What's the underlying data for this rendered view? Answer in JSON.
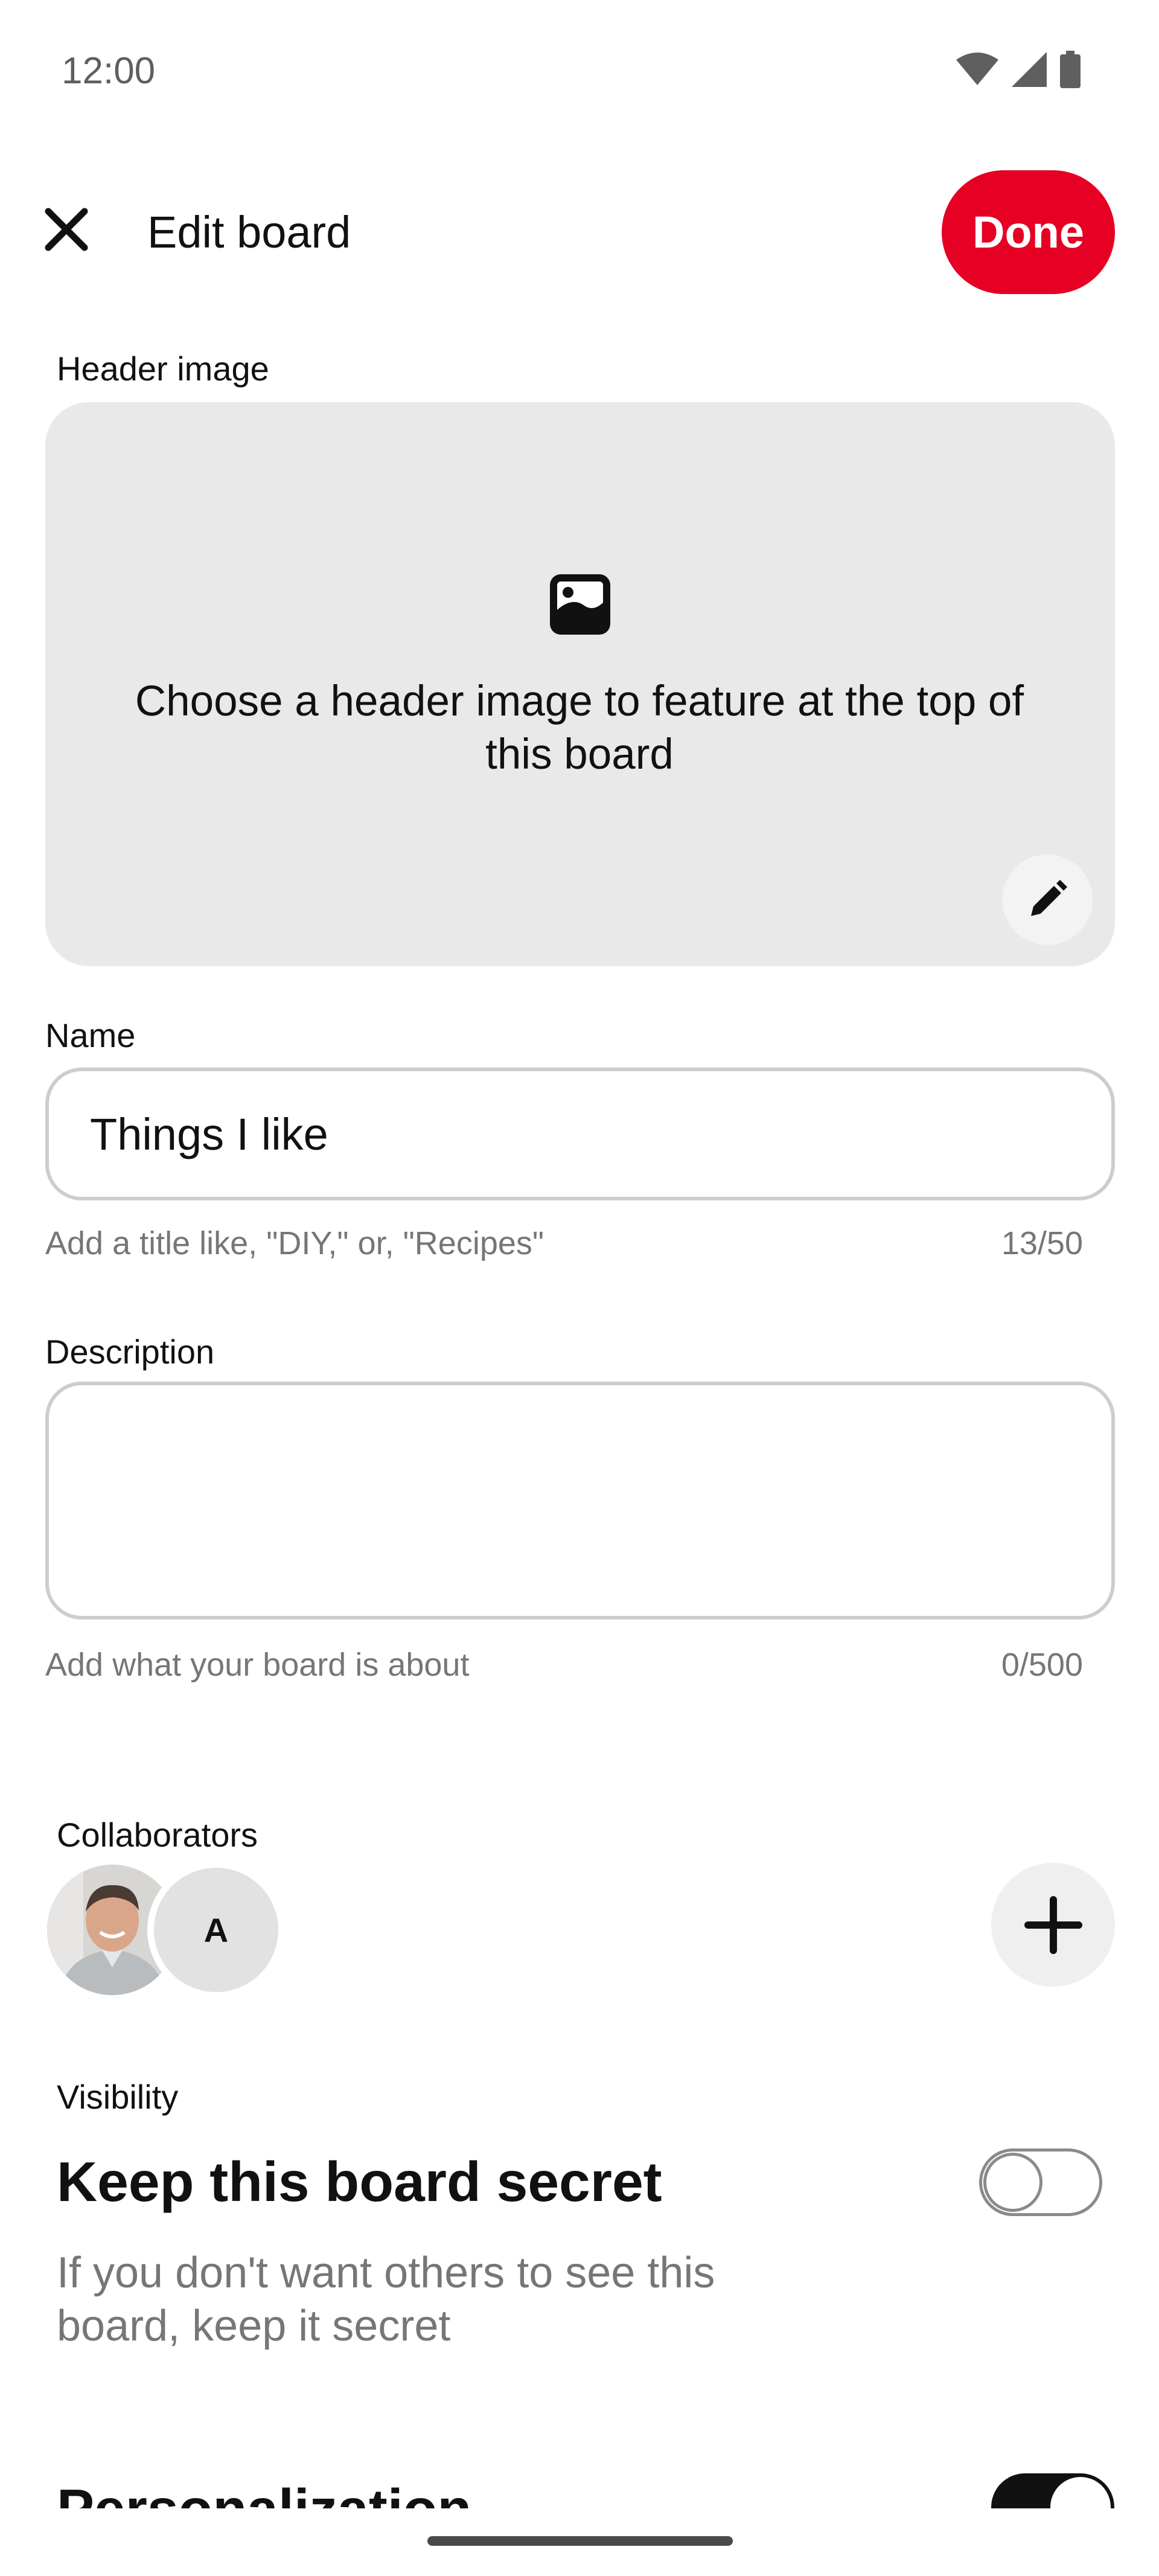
{
  "status_bar": {
    "time": "12:00",
    "icons": [
      "wifi-icon",
      "cellular-signal-icon",
      "battery-icon"
    ]
  },
  "top_bar": {
    "close_icon": "close-icon",
    "title": "Edit board",
    "done_label": "Done"
  },
  "header_image": {
    "label": "Header image",
    "icon": "image-icon",
    "prompt": "Choose a header image to feature at the top of this board",
    "edit_icon": "pencil-icon"
  },
  "name": {
    "label": "Name",
    "value": "Things I like",
    "helper": "Add a title like, \"DIY,\" or, \"Recipes\"",
    "counter": "13/50"
  },
  "description": {
    "label": "Description",
    "value": "",
    "helper": "Add what your board is about",
    "counter": "0/500"
  },
  "collaborators": {
    "label": "Collaborators",
    "members": [
      {
        "type": "photo"
      },
      {
        "type": "initial",
        "initial": "A"
      }
    ],
    "add_icon": "plus-icon"
  },
  "visibility": {
    "label": "Visibility",
    "heading": "Keep this board secret",
    "description": "If you don't want others to see this board, keep it secret",
    "toggle_on": false
  },
  "personalization": {
    "heading": "Personalization",
    "toggle_on": true
  },
  "colors": {
    "accent": "#e60023",
    "card_background": "#e9e9e9",
    "muted_text": "#767676",
    "border": "#cdcdcd"
  }
}
